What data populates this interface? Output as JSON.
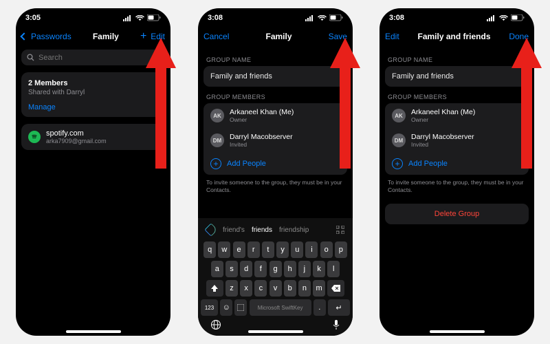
{
  "colors": {
    "accent": "#0a84ff",
    "danger": "#ff453a"
  },
  "phone1": {
    "time": "3:05",
    "nav": {
      "back": "Passwords",
      "title": "Family",
      "plus": "+",
      "edit": "Edit"
    },
    "search_placeholder": "Search",
    "members": {
      "title": "2 Members",
      "subtitle": "Shared with Darryl",
      "manage": "Manage"
    },
    "entry": {
      "site": "spotify.com",
      "email": "arka7909@gmail.com",
      "icon": "spotify-icon"
    }
  },
  "phone2": {
    "time": "3:08",
    "nav": {
      "cancel": "Cancel",
      "title": "Family",
      "save": "Save"
    },
    "group_name_header": "GROUP NAME",
    "group_name_value": "Family and friends",
    "members_header": "GROUP MEMBERS",
    "members": [
      {
        "initials": "AK",
        "name": "Arkaneel Khan (Me)",
        "role": "Owner"
      },
      {
        "initials": "DM",
        "name": "Darryl Macobserver",
        "role": "Invited"
      }
    ],
    "add_people": "Add People",
    "hint": "To invite someone to the group, they must be in your Contacts.",
    "suggestions": [
      "friend's",
      "friends",
      "friendship"
    ],
    "keyboard": {
      "row1": [
        "q",
        "w",
        "e",
        "r",
        "t",
        "y",
        "u",
        "i",
        "o",
        "p"
      ],
      "row2": [
        "a",
        "s",
        "d",
        "f",
        "g",
        "h",
        "j",
        "k",
        "l"
      ],
      "row3": [
        "z",
        "x",
        "c",
        "v",
        "b",
        "n",
        "m"
      ],
      "numkey": "123",
      "space_label": "Microsoft SwiftKey",
      "return": "↵"
    }
  },
  "phone3": {
    "time": "3:08",
    "nav": {
      "edit": "Edit",
      "title": "Family and friends",
      "done": "Done"
    },
    "group_name_header": "GROUP NAME",
    "group_name_value": "Family and friends",
    "members_header": "GROUP MEMBERS",
    "members": [
      {
        "initials": "AK",
        "name": "Arkaneel Khan (Me)",
        "role": "Owner"
      },
      {
        "initials": "DM",
        "name": "Darryl Macobserver",
        "role": "Invited"
      }
    ],
    "add_people": "Add People",
    "hint": "To invite someone to the group, they must be in your Contacts.",
    "delete": "Delete Group"
  }
}
